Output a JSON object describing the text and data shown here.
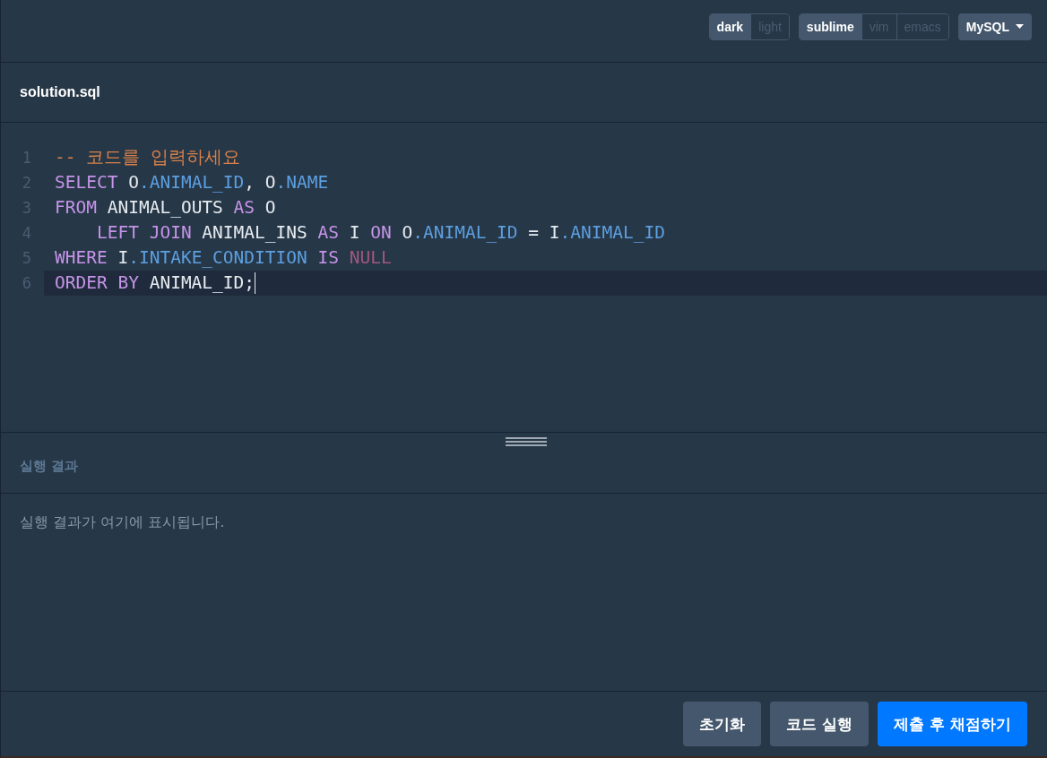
{
  "toolbar": {
    "groups": [
      {
        "options": [
          {
            "label": "dark",
            "selected": true
          },
          {
            "label": "light",
            "selected": false
          }
        ]
      },
      {
        "options": [
          {
            "label": "sublime",
            "selected": true
          },
          {
            "label": "vim",
            "selected": false
          },
          {
            "label": "emacs",
            "selected": false
          }
        ]
      }
    ],
    "language_dropdown": {
      "value": "MySQL"
    }
  },
  "editor": {
    "filename": "solution.sql",
    "lines": [
      {
        "number": "1",
        "selected": false,
        "tokens": [
          {
            "kind": "comment",
            "text": "-- 코드를 입력하세요"
          }
        ]
      },
      {
        "number": "2",
        "selected": false,
        "tokens": [
          {
            "kind": "keyword",
            "text": "SELECT"
          },
          {
            "kind": "plain",
            "text": " O"
          },
          {
            "kind": "field",
            "text": ".ANIMAL_ID"
          },
          {
            "kind": "plain",
            "text": ", O"
          },
          {
            "kind": "field",
            "text": ".NAME"
          }
        ]
      },
      {
        "number": "3",
        "selected": false,
        "tokens": [
          {
            "kind": "keyword",
            "text": "FROM"
          },
          {
            "kind": "plain",
            "text": " ANIMAL_OUTS "
          },
          {
            "kind": "keyword",
            "text": "AS"
          },
          {
            "kind": "plain",
            "text": " O"
          }
        ]
      },
      {
        "number": "4",
        "selected": false,
        "tokens": [
          {
            "kind": "keyword",
            "text": "    LEFT JOIN"
          },
          {
            "kind": "plain",
            "text": " ANIMAL_INS "
          },
          {
            "kind": "keyword",
            "text": "AS"
          },
          {
            "kind": "plain",
            "text": " I "
          },
          {
            "kind": "keyword",
            "text": "ON"
          },
          {
            "kind": "plain",
            "text": " O"
          },
          {
            "kind": "field",
            "text": ".ANIMAL_ID"
          },
          {
            "kind": "plain",
            "text": " = I"
          },
          {
            "kind": "field",
            "text": ".ANIMAL_ID"
          }
        ]
      },
      {
        "number": "5",
        "selected": false,
        "tokens": [
          {
            "kind": "keyword",
            "text": "WHERE"
          },
          {
            "kind": "plain",
            "text": " I"
          },
          {
            "kind": "field",
            "text": ".INTAKE_CONDITION"
          },
          {
            "kind": "keyword",
            "text": " IS"
          },
          {
            "kind": "null",
            "text": " NULL"
          }
        ]
      },
      {
        "number": "6",
        "selected": true,
        "tokens": [
          {
            "kind": "keyword",
            "text": "ORDER BY"
          },
          {
            "kind": "plain",
            "text": " ANIMAL_ID;"
          }
        ]
      }
    ]
  },
  "result": {
    "title": "실행 결과",
    "message": "실행 결과가 여기에 표시됩니다."
  },
  "buttons": [
    {
      "label": "초기화",
      "kind": "secondary"
    },
    {
      "label": "코드 실행",
      "kind": "secondary"
    },
    {
      "label": "제출 후 채점하기",
      "kind": "primary"
    }
  ]
}
